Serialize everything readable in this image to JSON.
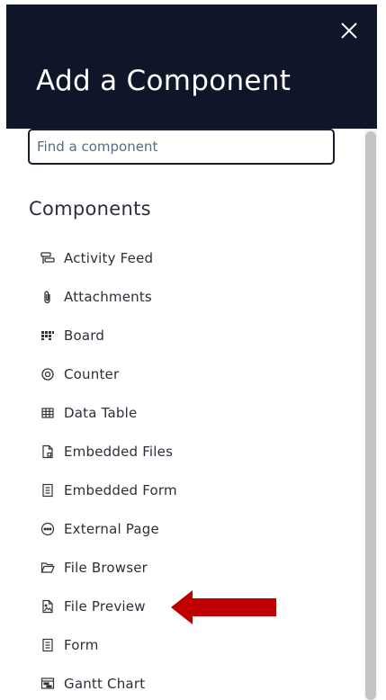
{
  "panel": {
    "title": "Add a Component",
    "close_icon": "close-icon"
  },
  "search": {
    "placeholder": "Find a component",
    "value": ""
  },
  "components": {
    "heading": "Components",
    "items": [
      {
        "label": "Activity Feed",
        "icon": "activity-feed-icon"
      },
      {
        "label": "Attachments",
        "icon": "paperclip-icon"
      },
      {
        "label": "Board",
        "icon": "board-icon"
      },
      {
        "label": "Counter",
        "icon": "counter-icon"
      },
      {
        "label": "Data Table",
        "icon": "table-icon"
      },
      {
        "label": "Embedded Files",
        "icon": "file-icon"
      },
      {
        "label": "Embedded Form",
        "icon": "form-icon"
      },
      {
        "label": "External Page",
        "icon": "ellipsis-circle-icon"
      },
      {
        "label": "File Browser",
        "icon": "folder-open-icon"
      },
      {
        "label": "File Preview",
        "icon": "file-image-icon"
      },
      {
        "label": "Form",
        "icon": "form-icon"
      },
      {
        "label": "Gantt Chart",
        "icon": "gantt-chart-icon"
      }
    ]
  },
  "annotation": {
    "arrow_color": "#c00000",
    "points_to": "File Preview"
  },
  "colors": {
    "header_bg": "#0f1629",
    "text": "#2b2f38",
    "scrollbar_thumb": "#c4c4c4"
  }
}
